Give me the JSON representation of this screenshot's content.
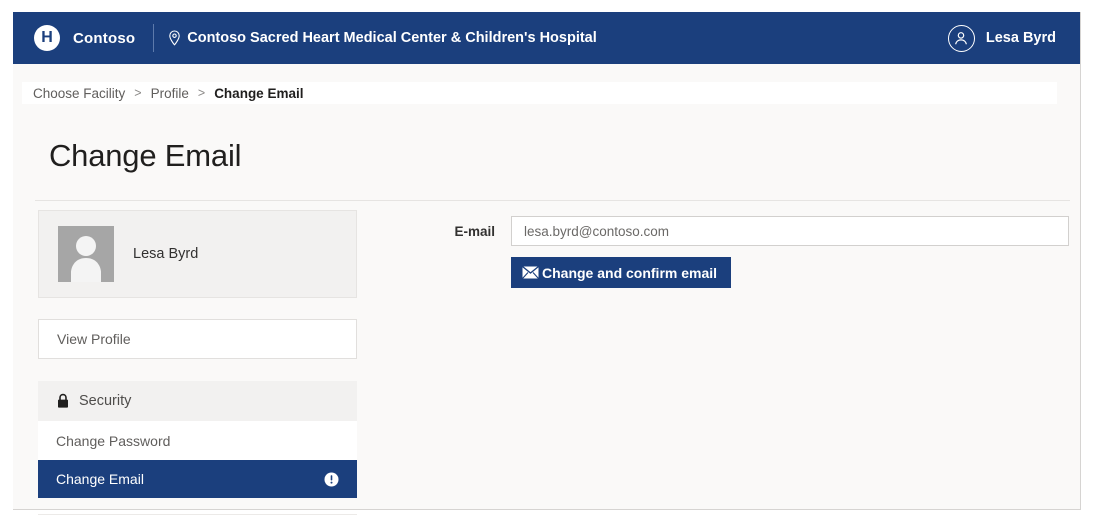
{
  "header": {
    "brand_initial": "H",
    "brand_name": "Contoso",
    "facility_name": "Contoso Sacred Heart Medical Center & Children's Hospital",
    "pin_icon": "location-pin-icon",
    "user_name": "Lesa Byrd",
    "user_avatar_icon": "user-circle-icon",
    "background_color": "#1b3f7d"
  },
  "breadcrumb": {
    "items": [
      {
        "label": "Choose Facility",
        "current": false
      },
      {
        "label": "Profile",
        "current": false
      },
      {
        "label": "Change Email",
        "current": true
      }
    ],
    "separator": ">"
  },
  "page": {
    "title": "Change Email"
  },
  "profile_card": {
    "name": "Lesa Byrd",
    "photo_icon": "user-placeholder-photo"
  },
  "sidebar": {
    "view_profile": {
      "label": "View Profile"
    },
    "security_group": {
      "label": "Security",
      "icon": "lock-icon",
      "items": [
        {
          "label": "Change Password",
          "active": false,
          "icon": null
        },
        {
          "label": "Change Email",
          "active": true,
          "icon": "info-icon"
        }
      ]
    }
  },
  "form": {
    "email_label": "E-mail",
    "email_value": "",
    "email_placeholder": "lesa.byrd@contoso.com",
    "submit_label": "Change and confirm email",
    "submit_icon": "envelope-icon",
    "submit_color": "#1b3f7d"
  }
}
